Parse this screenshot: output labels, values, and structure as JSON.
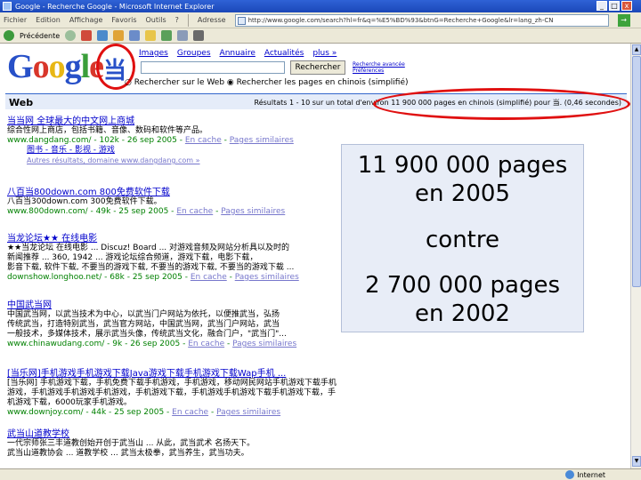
{
  "window": {
    "title": "Google - Recherche Google - Microsoft Internet Explorer",
    "minimize": "_",
    "maximize": "□",
    "close": "x"
  },
  "menu": {
    "items": [
      "Fichier",
      "Edition",
      "Affichage",
      "Favoris",
      "Outils",
      "?"
    ],
    "address_label": "Adresse",
    "address_value": "http://www.google.com/search?hl=fr&q=%E5%BD%93&btnG=Recherche+Google&lr=lang_zh-CN",
    "go": "→"
  },
  "toolbar": {
    "back": "Précédente"
  },
  "google": {
    "logo_letters": [
      "G",
      "o",
      "o",
      "g",
      "l",
      "e"
    ],
    "query_char": "当",
    "tabs": [
      "Images",
      "Groupes",
      "Annuaire",
      "Actualités",
      "plus »"
    ],
    "search_button": "Rechercher",
    "advanced_link": "Recherche avancée",
    "prefs_link": "Préférences",
    "radio_web": "Rechercher sur le Web",
    "radio_cn": "Rechercher les pages en chinois (simplifié)",
    "web_label": "Web",
    "results_text": "Résultats 1 - 10 sur un total d'environ 11 900 000 pages en chinois (simplifié) pour 当. (0,46 secondes)"
  },
  "results": [
    {
      "title": "当当网 全球最大的中文网上商城",
      "snippets": [
        "综合性网上商店，包括书籍、音像、数码和软件等产品。"
      ],
      "url": "www.dangdang.com/ - 102k - 26 sep 2005 -",
      "cache": "En cache",
      "similar": "Pages similaires",
      "subs": [
        "图书 - 音乐 - 影视 - 游戏",
        "Autres résultats, domaine www.dangdang.com »"
      ]
    },
    {
      "title": "八百当800down.com 800免费软件下载",
      "snippets": [
        "八百当300down.com 300免费软件下载。"
      ],
      "url": "www.800down.com/ - 49k - 25 sep 2005 -",
      "cache": "En cache",
      "similar": "Pages similaires"
    },
    {
      "title": "当龙论坛★★ 在线电影",
      "snippets": [
        "★★当龙论坛 在线电影 ... Discuz! Board ... 对游戏音频及网站分析具以及时的",
        "新闻推荐 ... 360, 1942 ... 游戏论坛综合频道，游戏下载，电影下载，",
        "影音下载, 软件下载, 不要当的游戏下载, 不要当的游戏下载, 不要当的游戏下载 ..."
      ],
      "url": "downshow.longhoo.net/ - 68k - 25 sep 2005 -",
      "cache": "En cache",
      "similar": "Pages similaires"
    },
    {
      "title": "中国武当网",
      "snippets": [
        "中国武当网，以武当技术为中心，以武当门户网站为依托，以便推武当，弘扬",
        "传统武当，打造特别武当，武当官方网站，中国武当网，武当门户网站，武当",
        "一般技术，多媒体技术，展示武当头像，传统武当文化，融合门户，\"武当门\"..."
      ],
      "url": "www.chinawudang.com/ - 9k - 26 sep 2005 -",
      "cache": "En cache",
      "similar": "Pages similaires"
    },
    {
      "title": "[当乐网]手机游戏手机游戏下载Java游戏下载手机游戏下载Wap手机 ...",
      "snippets": [
        "[当乐网] 手机游戏下载，手机免费下载手机游戏，手机游戏，移动网民网站手机游戏下载手机",
        "游戏，手机游戏手机游戏手机游戏，手机游戏下载，手机游戏手机游戏下载手机游戏下载，手机游戏下载，6000玩家手机游戏。"
      ],
      "url": "www.downjoy.com/ - 44k - 25 sep 2005 -",
      "cache": "En cache",
      "similar": "Pages similaires"
    },
    {
      "title": "武当山道教学校",
      "snippets": [
        "一代宗师张三丰道教创始开创于武当山 ... 从此，武当武术 名扬天下。",
        "武当山道教协会 ... 道教学校 ... 武当太极拳，武当养生，武当功夫。"
      ],
      "url": "",
      "cache": "",
      "similar": ""
    }
  ],
  "overlay": {
    "line1": "11 900 000 pages",
    "line2": "en 2005",
    "line3": "contre",
    "line4": "2 700 000 pages",
    "line5": "en 2002"
  },
  "status": {
    "zone": "Internet"
  },
  "colors": {
    "highlight": "#e01010",
    "link": "#0000cc",
    "url": "#008000",
    "overlay_bg": "#e8edf7"
  }
}
